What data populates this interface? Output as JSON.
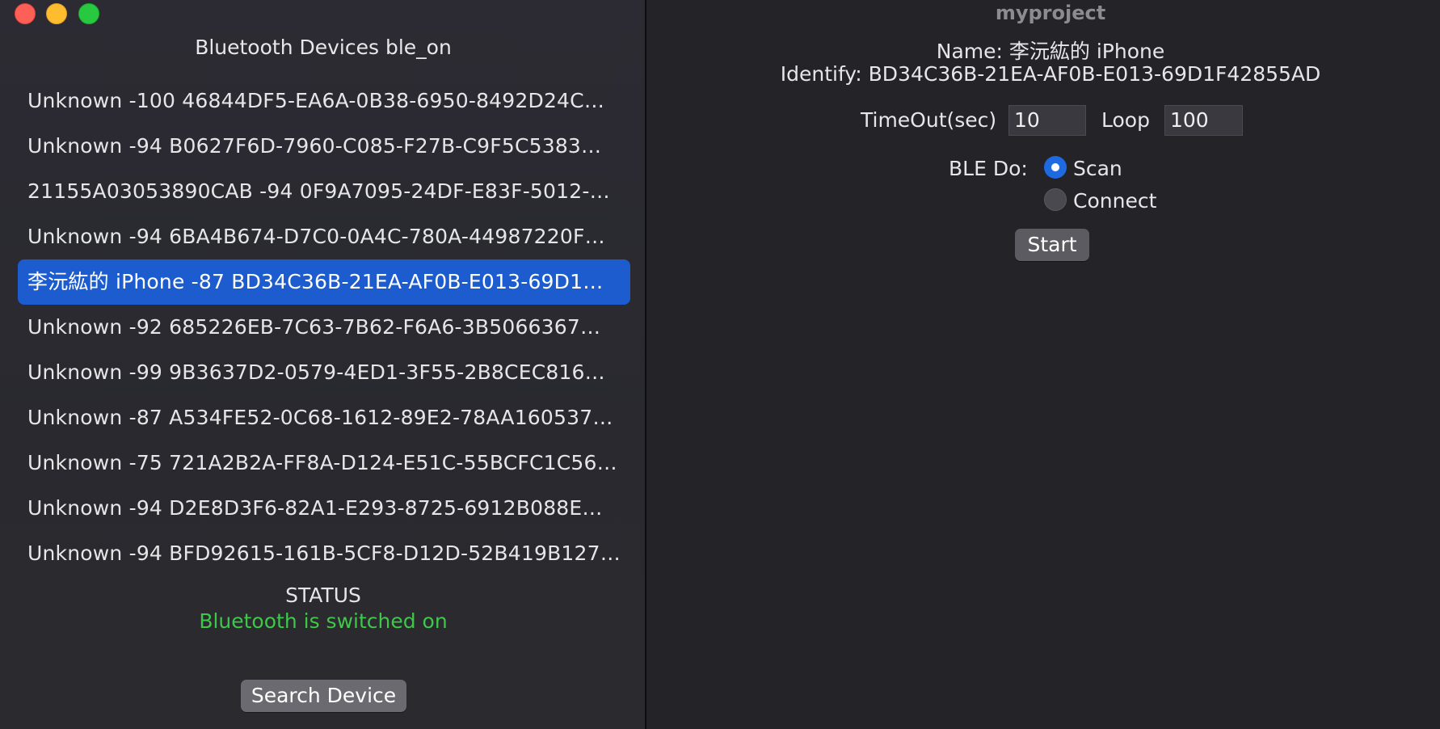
{
  "window": {
    "title": "myproject"
  },
  "sidebar": {
    "title": "Bluetooth Devices ble_on",
    "devices": [
      "Unknown  -100  46844DF5-EA6A-0B38-6950-8492D24C…",
      "Unknown  -94  B0627F6D-7960-C085-F27B-C9F5C5383…",
      "21155A03053890CAB  -94  0F9A7095-24DF-E83F-5012-…",
      "Unknown  -94  6BA4B674-D7C0-0A4C-780A-44987220F…",
      "李沅紘的 iPhone  -87  BD34C36B-21EA-AF0B-E013-69D1…",
      "Unknown  -92  685226EB-7C63-7B62-F6A6-3B5066367…",
      "Unknown  -99  9B3637D2-0579-4ED1-3F55-2B8CEC816…",
      "Unknown  -87  A534FE52-0C68-1612-89E2-78AA160537…",
      "Unknown  -75  721A2B2A-FF8A-D124-E51C-55BCFC1C56…",
      "Unknown  -94  D2E8D3F6-82A1-E293-8725-6912B088E…",
      "Unknown  -94  BFD92615-161B-5CF8-D12D-52B419B127…"
    ],
    "selected_index": 4,
    "status_label": "STATUS",
    "status_value": "Bluetooth is switched on",
    "search_button": "Search Device"
  },
  "detail": {
    "name_line": "Name: 李沅紘的 iPhone",
    "identify_line": "Identify: BD34C36B-21EA-AF0B-E013-69D1F42855AD",
    "timeout_label": "TimeOut(sec)",
    "timeout_value": "10",
    "loop_label": "Loop",
    "loop_value": "100",
    "ble_do_label": "BLE Do:",
    "scan_label": "Scan",
    "connect_label": "Connect",
    "selected_mode": "Scan",
    "start_button": "Start"
  },
  "colors": {
    "selection": "#1c5ccf",
    "status_ok": "#3fc74a",
    "radio_on": "#1e6ae0"
  }
}
